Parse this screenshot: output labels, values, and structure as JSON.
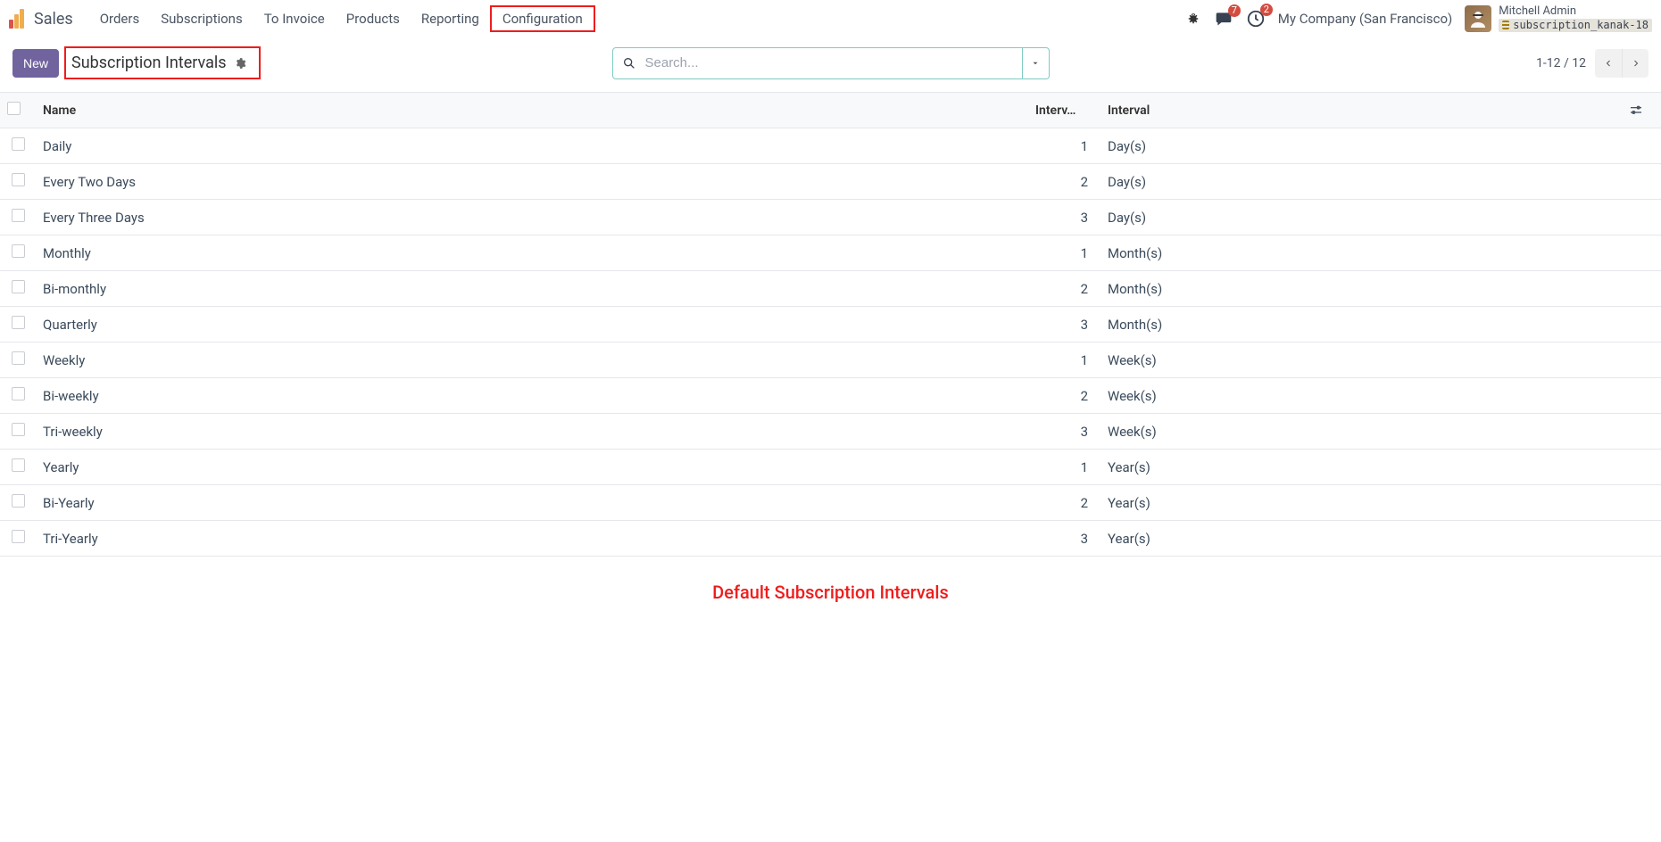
{
  "app": {
    "title": "Sales"
  },
  "nav": {
    "items": [
      {
        "label": "Orders"
      },
      {
        "label": "Subscriptions"
      },
      {
        "label": "To Invoice"
      },
      {
        "label": "Products"
      },
      {
        "label": "Reporting"
      },
      {
        "label": "Configuration",
        "highlighted": true
      }
    ]
  },
  "header_right": {
    "chat_badge": "7",
    "clock_badge": "2",
    "company": "My Company (San Francisco)",
    "user_name": "Mitchell Admin",
    "db_name": "subscription_kanak-18"
  },
  "controls": {
    "new_label": "New",
    "page_title": "Subscription Intervals",
    "search_placeholder": "Search...",
    "pager_text": "1-12 / 12"
  },
  "table": {
    "headers": {
      "name": "Name",
      "count": "Interv…",
      "unit": "Interval"
    },
    "rows": [
      {
        "name": "Daily",
        "count": "1",
        "unit": "Day(s)"
      },
      {
        "name": "Every Two Days",
        "count": "2",
        "unit": "Day(s)"
      },
      {
        "name": "Every Three Days",
        "count": "3",
        "unit": "Day(s)"
      },
      {
        "name": "Monthly",
        "count": "1",
        "unit": "Month(s)"
      },
      {
        "name": "Bi-monthly",
        "count": "2",
        "unit": "Month(s)"
      },
      {
        "name": "Quarterly",
        "count": "3",
        "unit": "Month(s)"
      },
      {
        "name": "Weekly",
        "count": "1",
        "unit": "Week(s)"
      },
      {
        "name": "Bi-weekly",
        "count": "2",
        "unit": "Week(s)"
      },
      {
        "name": "Tri-weekly",
        "count": "3",
        "unit": "Week(s)"
      },
      {
        "name": "Yearly",
        "count": "1",
        "unit": "Year(s)"
      },
      {
        "name": "Bi-Yearly",
        "count": "2",
        "unit": "Year(s)"
      },
      {
        "name": "Tri-Yearly",
        "count": "3",
        "unit": "Year(s)"
      }
    ]
  },
  "caption": "Default Subscription Intervals"
}
